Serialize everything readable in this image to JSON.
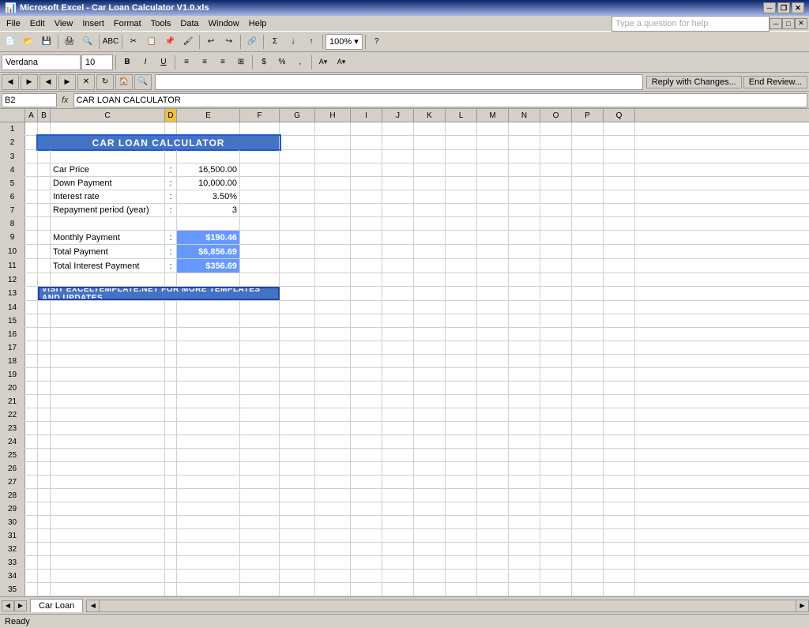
{
  "titleBar": {
    "title": "Microsoft Excel - Car Loan Calculator V1.0.xls",
    "closeBtn": "✕",
    "maxBtn": "□",
    "minBtn": "─",
    "restoreBtn": "❐",
    "appClose": "✕",
    "appMin": "─"
  },
  "menuBar": {
    "items": [
      "File",
      "Edit",
      "View",
      "Insert",
      "Format",
      "Tools",
      "Data",
      "Window",
      "Help"
    ]
  },
  "toolbar2": {
    "fontName": "Verdana",
    "fontSize": "10"
  },
  "formulaBar": {
    "nameBox": "B2",
    "formula": "CAR LOAN CALCULATOR"
  },
  "notifyBar": {
    "replyBtn": "Reply with Changes...",
    "endBtn": "End Review..."
  },
  "helpBox": {
    "placeholder": "Type a question for help"
  },
  "columns": {
    "headers": [
      "A",
      "B",
      "C",
      "D",
      "E",
      "F",
      "G",
      "H",
      "I",
      "J",
      "K",
      "L",
      "M",
      "N",
      "O",
      "P",
      "Q"
    ],
    "widths": [
      32,
      16,
      100,
      80,
      70,
      60,
      50,
      50,
      40,
      40,
      40,
      40,
      40,
      40,
      40,
      40,
      40
    ]
  },
  "rows": [
    {
      "num": 1,
      "cells": []
    },
    {
      "num": 2,
      "cells": [
        {
          "col": "B",
          "value": "CAR LOAN CALCULATOR",
          "style": "blue-bg merged",
          "span": 5
        }
      ]
    },
    {
      "num": 3,
      "cells": []
    },
    {
      "num": 4,
      "cells": [
        {
          "col": "C",
          "value": "Car Price",
          "style": ""
        },
        {
          "col": "D",
          "value": ":",
          "style": "center-align"
        },
        {
          "col": "E",
          "value": "16,500.00",
          "style": "right-align"
        }
      ]
    },
    {
      "num": 5,
      "cells": [
        {
          "col": "C",
          "value": "Down Payment",
          "style": ""
        },
        {
          "col": "D",
          "value": ":",
          "style": "center-align"
        },
        {
          "col": "E",
          "value": "10,000.00",
          "style": "right-align"
        }
      ]
    },
    {
      "num": 6,
      "cells": [
        {
          "col": "C",
          "value": "Interest rate",
          "style": ""
        },
        {
          "col": "D",
          "value": ":",
          "style": "center-align"
        },
        {
          "col": "E",
          "value": "3.50%",
          "style": "right-align"
        }
      ]
    },
    {
      "num": 7,
      "cells": [
        {
          "col": "C",
          "value": "Repayment period (year)",
          "style": ""
        },
        {
          "col": "D",
          "value": ":",
          "style": "center-align"
        },
        {
          "col": "E",
          "value": "3",
          "style": "right-align"
        }
      ]
    },
    {
      "num": 8,
      "cells": []
    },
    {
      "num": 9,
      "cells": [
        {
          "col": "C",
          "value": "Monthly Payment",
          "style": ""
        },
        {
          "col": "D",
          "value": ":",
          "style": "center-align"
        },
        {
          "col": "E",
          "value": "$190.46",
          "style": "highlight-blue right-align bold"
        }
      ]
    },
    {
      "num": 10,
      "cells": [
        {
          "col": "C",
          "value": "Total Payment",
          "style": ""
        },
        {
          "col": "D",
          "value": ":",
          "style": "center-align"
        },
        {
          "col": "E",
          "value": "$6,856.69",
          "style": "highlight-blue right-align bold"
        }
      ]
    },
    {
      "num": 11,
      "cells": [
        {
          "col": "C",
          "value": "Total Interest Payment",
          "style": ""
        },
        {
          "col": "D",
          "value": ":",
          "style": "center-align"
        },
        {
          "col": "E",
          "value": "$356.69",
          "style": "highlight-blue right-align bold"
        }
      ]
    },
    {
      "num": 12,
      "cells": []
    },
    {
      "num": 13,
      "cells": [
        {
          "col": "B",
          "value": "VISIT EXCELTEMPLATE.NET FOR MORE TEMPLATES AND UPDATES",
          "style": "blue-border-btn merged",
          "span": 5
        }
      ]
    },
    {
      "num": 14,
      "cells": []
    },
    {
      "num": 15,
      "cells": []
    },
    {
      "num": 16,
      "cells": []
    },
    {
      "num": 17,
      "cells": []
    },
    {
      "num": 18,
      "cells": []
    },
    {
      "num": 19,
      "cells": []
    },
    {
      "num": 20,
      "cells": []
    },
    {
      "num": 21,
      "cells": []
    },
    {
      "num": 22,
      "cells": []
    },
    {
      "num": 23,
      "cells": []
    },
    {
      "num": 24,
      "cells": []
    },
    {
      "num": 25,
      "cells": []
    },
    {
      "num": 26,
      "cells": []
    },
    {
      "num": 27,
      "cells": []
    },
    {
      "num": 28,
      "cells": []
    },
    {
      "num": 29,
      "cells": []
    },
    {
      "num": 30,
      "cells": []
    },
    {
      "num": 31,
      "cells": []
    },
    {
      "num": 32,
      "cells": []
    },
    {
      "num": 33,
      "cells": []
    },
    {
      "num": 34,
      "cells": []
    },
    {
      "num": 35,
      "cells": []
    }
  ],
  "sheetTab": {
    "name": "Car Loan"
  },
  "statusBar": {
    "text": "Ready"
  }
}
